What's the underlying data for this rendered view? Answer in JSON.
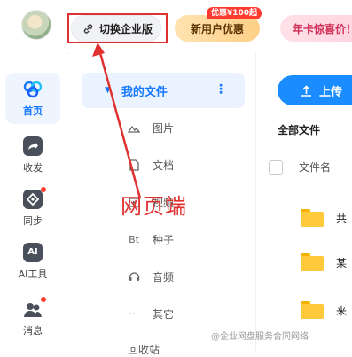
{
  "topbar": {
    "switch_enterprise_label": "切换企业版",
    "new_user_label": "新用户优惠",
    "promo_badge": "优惠¥100起",
    "annual_label": "年卡惊喜价！"
  },
  "rail": {
    "items": [
      {
        "label": "首页",
        "icon": "cloud-home-icon",
        "active": true
      },
      {
        "label": "收发",
        "icon": "share-arrow-icon",
        "active": false
      },
      {
        "label": "同步",
        "icon": "sync-icon",
        "active": false,
        "dot": true
      },
      {
        "label": "AI工具",
        "icon": "ai-icon",
        "active": false
      },
      {
        "label": "消息",
        "icon": "message-icon",
        "active": false,
        "dot": true
      }
    ]
  },
  "tree": {
    "root_label": "我的文件",
    "items": [
      {
        "label": "图片",
        "icon": "image-icon"
      },
      {
        "label": "文档",
        "icon": "document-icon"
      },
      {
        "label": "视频",
        "icon": "video-icon"
      },
      {
        "label": "种子",
        "icon": "bt-icon",
        "icon_text": "Bt"
      },
      {
        "label": "音频",
        "icon": "headphones-icon"
      },
      {
        "label": "其它",
        "icon": "ellipsis-icon",
        "icon_text": "···"
      }
    ],
    "recycle_label": "回收站"
  },
  "content": {
    "upload_label": "上传",
    "all_files_label": "全部文件",
    "column_filename": "文件名",
    "rows": [
      {
        "name": "共"
      },
      {
        "name": "某"
      },
      {
        "name": "来"
      }
    ]
  },
  "annotation": {
    "label": "网页端",
    "color": "#e03131"
  },
  "watermark": "@企业网盘服务合同网络",
  "colors": {
    "accent": "#1677ff",
    "upload": "#1a8cff",
    "folder": "#ffc93c",
    "badge": "#ff3b30"
  }
}
